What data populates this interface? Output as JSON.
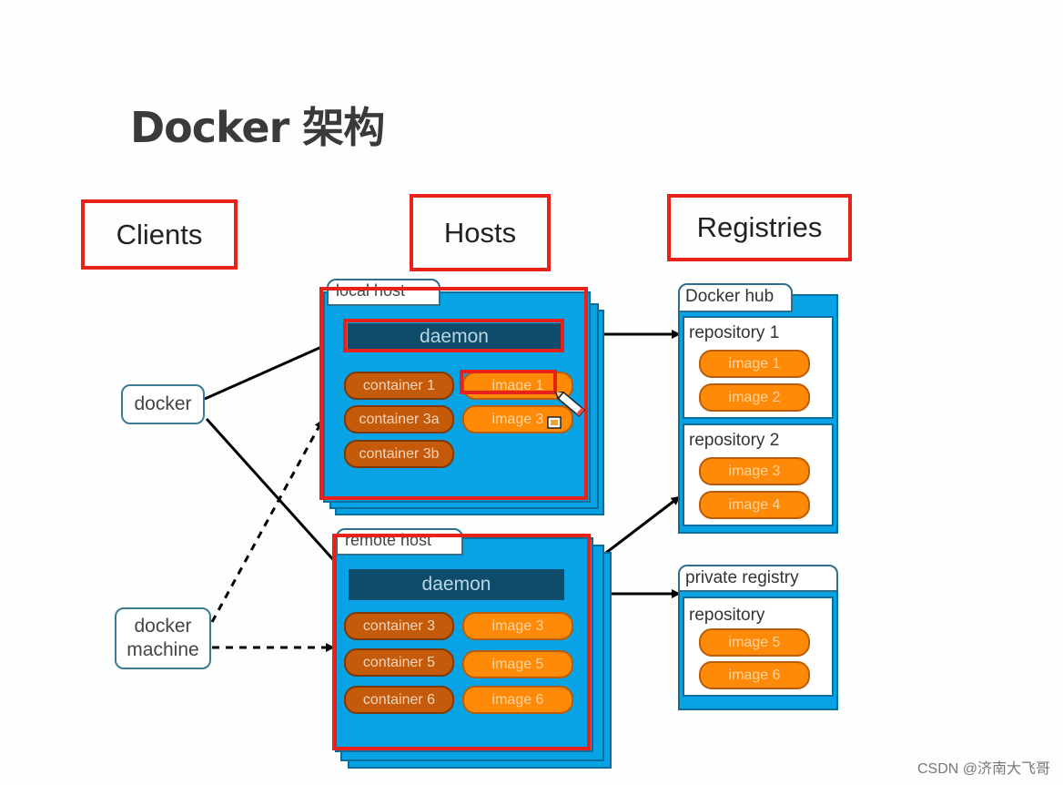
{
  "title": "Docker 架构",
  "sections": {
    "clients": "Clients",
    "hosts": "Hosts",
    "registries": "Registries"
  },
  "clients": {
    "docker": "docker",
    "docker_machine_line1": "docker",
    "docker_machine_line2": "machine"
  },
  "local_host": {
    "label": "local host",
    "daemon": "daemon",
    "containers": [
      "container 1",
      "container 3a",
      "container 3b"
    ],
    "images": [
      "image 1",
      "image 3"
    ]
  },
  "remote_host": {
    "label": "remote host",
    "daemon": "daemon",
    "containers": [
      "container 3",
      "container 5",
      "container 6"
    ],
    "images": [
      "image 3",
      "image 5",
      "image 6"
    ]
  },
  "docker_hub": {
    "label": "Docker hub",
    "repositories": [
      {
        "label": "repository 1",
        "images": [
          "image 1",
          "image 2"
        ]
      },
      {
        "label": "repository 2",
        "images": [
          "image 3",
          "image 4"
        ]
      }
    ]
  },
  "private_registry": {
    "label": "private registry",
    "repository": {
      "label": "repository",
      "images": [
        "image 5",
        "image 6"
      ]
    }
  },
  "watermark": "CSDN @济南大飞哥",
  "colors": {
    "highlight_red": "#e8211a",
    "host_blue": "#07a3e4",
    "daemon_navy": "#0f4c6b",
    "container_brown": "#c45a0a",
    "image_orange": "#fe8a07"
  }
}
